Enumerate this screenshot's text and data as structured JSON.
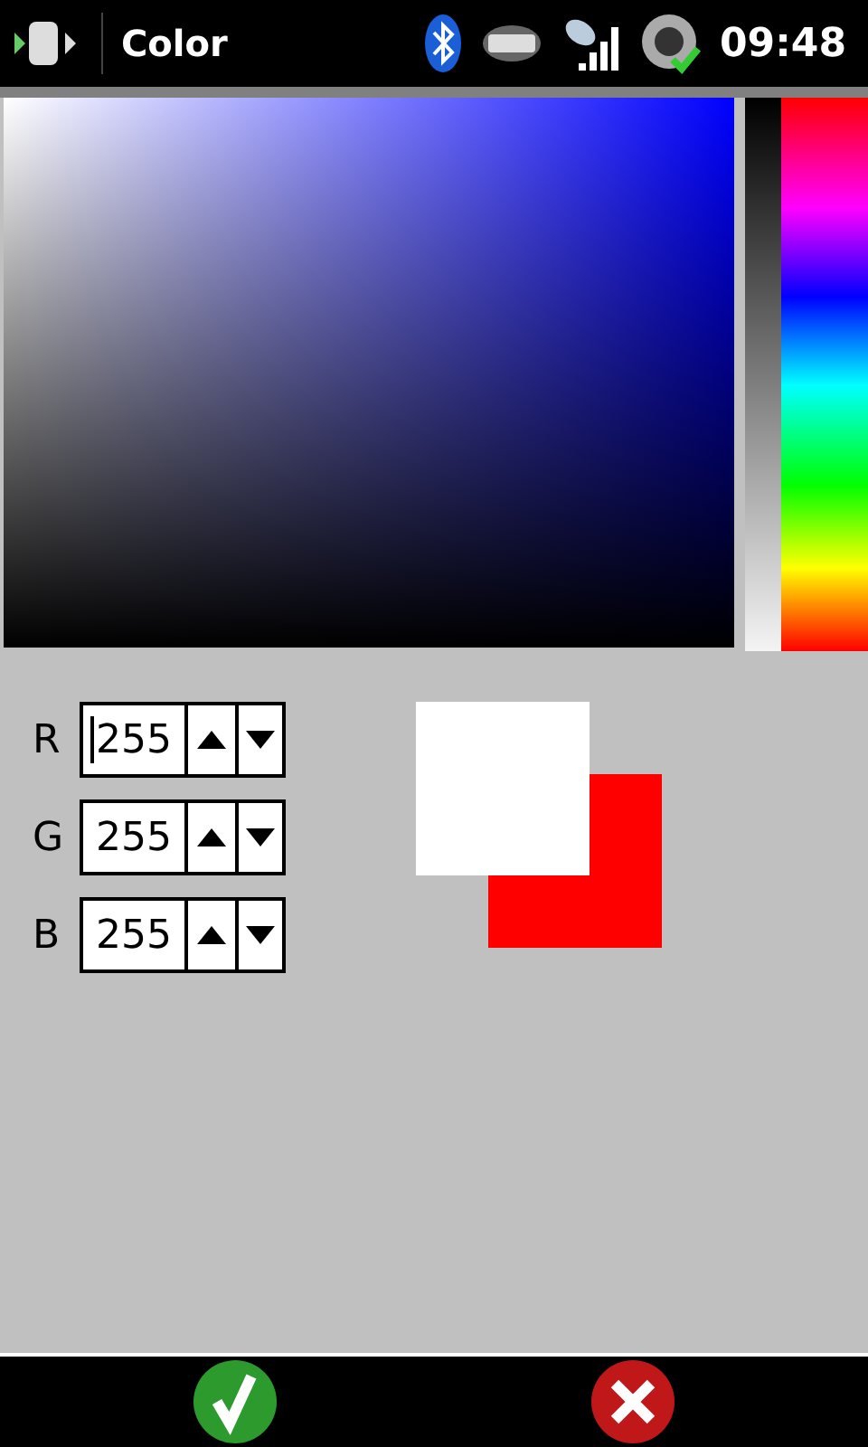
{
  "status_bar": {
    "title": "Color",
    "time": "09:48"
  },
  "channels": [
    {
      "label": "R",
      "value": "255",
      "focused": true
    },
    {
      "label": "G",
      "value": "255",
      "focused": false
    },
    {
      "label": "B",
      "value": "255",
      "focused": false
    }
  ],
  "swatches": [
    {
      "color": "#ffffff"
    },
    {
      "color": "#ff0000"
    }
  ]
}
